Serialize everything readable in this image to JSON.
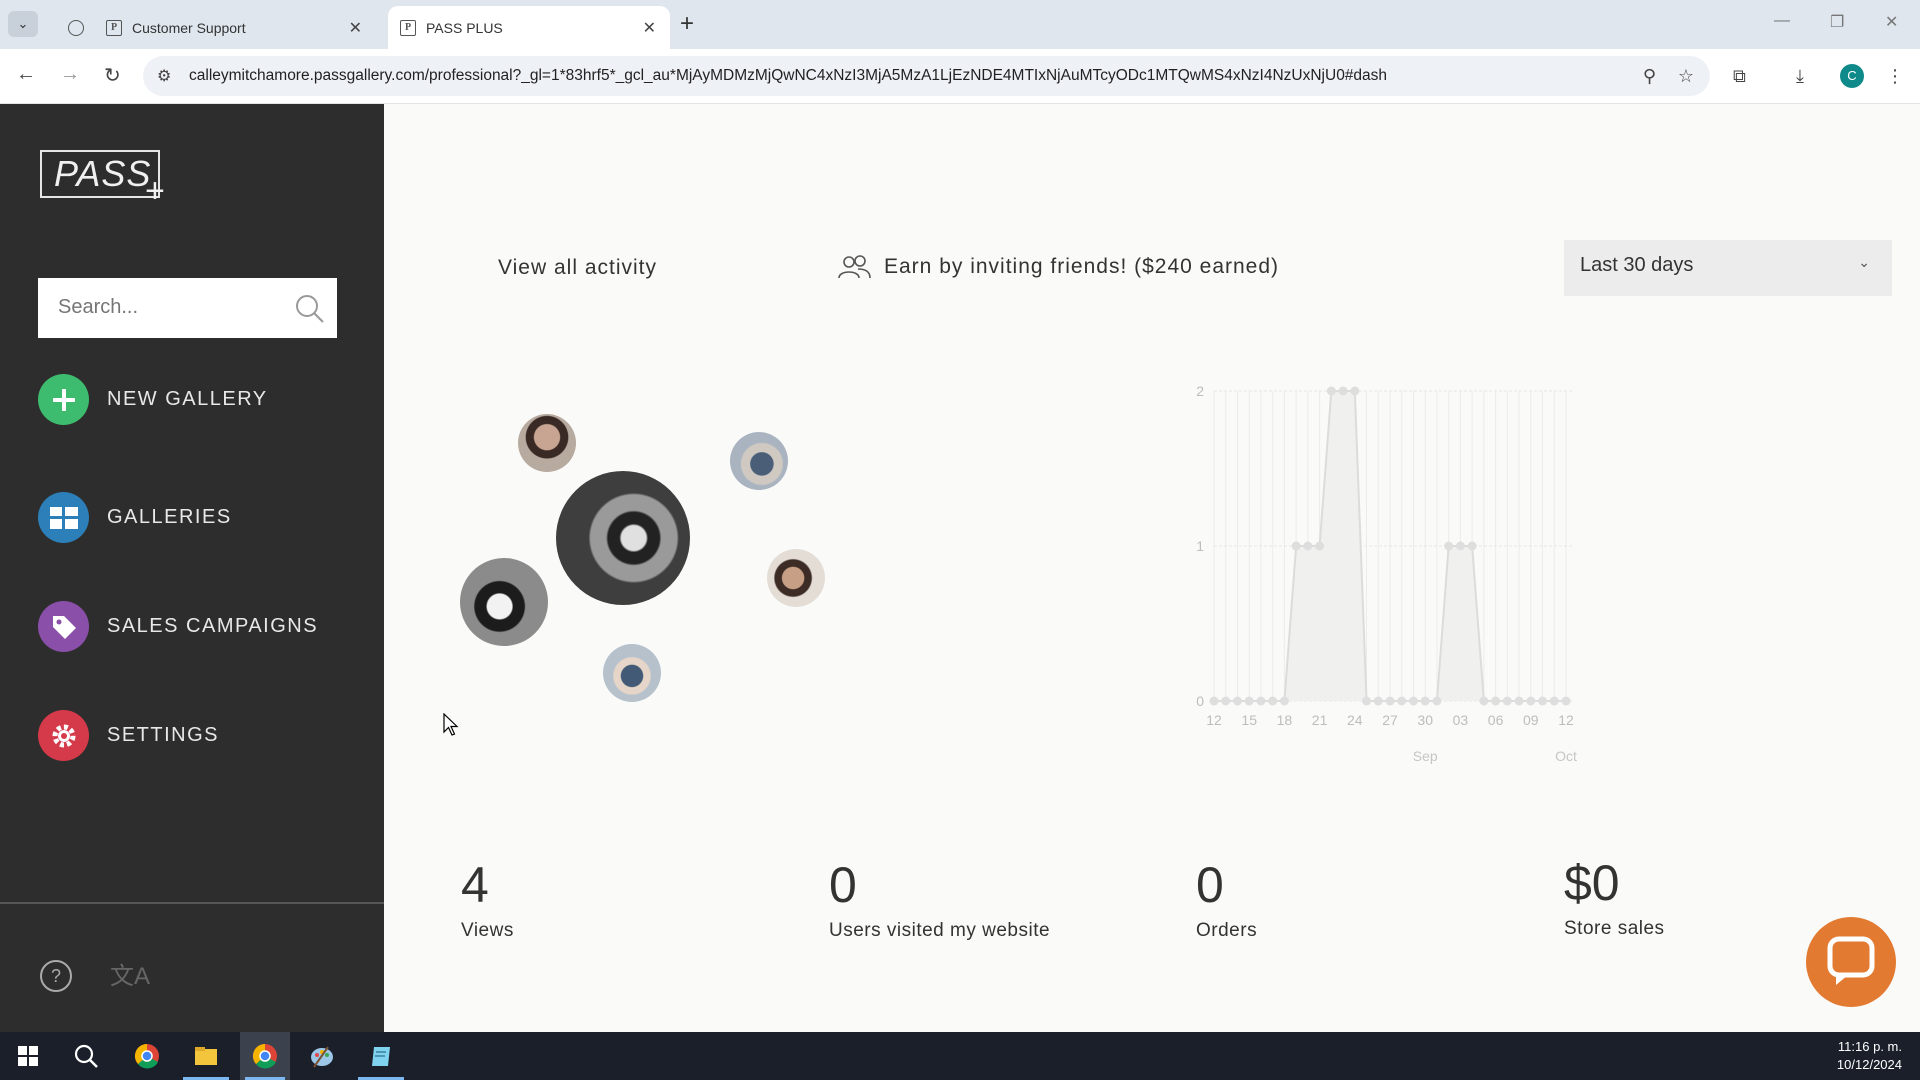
{
  "browser": {
    "tabs": [
      {
        "title": "Customer Support",
        "favicon": "P"
      },
      {
        "title": "PASS PLUS",
        "favicon": "P"
      }
    ],
    "url": "calleymitchamore.passgallery.com/professional?_gl=1*83hrf5*_gcl_au*MjAyMDMzMjQwNC4xNzI3MjA5MzA1LjEzNDE4MTIxNjAuMTcyODc1MTQwMS4xNzI4NzUxNjU0#dash",
    "profile_initial": "C"
  },
  "sidebar": {
    "logo": "PASS",
    "search_placeholder": "Search...",
    "items": [
      {
        "label": "NEW GALLERY",
        "color": "#3dbb6f",
        "icon": "plus-icon"
      },
      {
        "label": "GALLERIES",
        "color": "#2c7fb8",
        "icon": "grid-icon"
      },
      {
        "label": "SALES CAMPAIGNS",
        "color": "#8a4fa8",
        "icon": "tag-icon"
      },
      {
        "label": "SETTINGS",
        "color": "#d53a4a",
        "icon": "gear-icon"
      }
    ],
    "help": "?",
    "translate": "文A"
  },
  "main": {
    "view_all": "View all activity",
    "earn": "Earn by inviting friends! ($240 earned)",
    "date_range": "Last 30 days",
    "stats": [
      {
        "value": "4",
        "label": "Views"
      },
      {
        "value": "0",
        "label": "Users visited my website"
      },
      {
        "value": "0",
        "label": "Orders"
      },
      {
        "value": "$0",
        "label": "Store sales"
      }
    ]
  },
  "chart_data": {
    "type": "area",
    "x_ticks": [
      "12",
      "15",
      "18",
      "21",
      "24",
      "27",
      "30",
      "03",
      "06",
      "09",
      "12"
    ],
    "month_labels": [
      "Sep",
      "Oct"
    ],
    "y_ticks": [
      "0",
      "1",
      "2"
    ],
    "ylim": [
      0,
      2
    ],
    "series": [
      {
        "values": [
          0,
          0,
          0,
          0,
          0,
          0,
          0,
          1,
          1,
          1,
          2,
          2,
          2,
          0,
          0,
          0,
          0,
          0,
          0,
          0,
          1,
          1,
          1,
          0,
          0,
          0,
          0,
          0,
          0,
          0,
          0
        ]
      }
    ]
  },
  "taskbar": {
    "time": "11:16 p. m.",
    "date": "10/12/2024"
  }
}
